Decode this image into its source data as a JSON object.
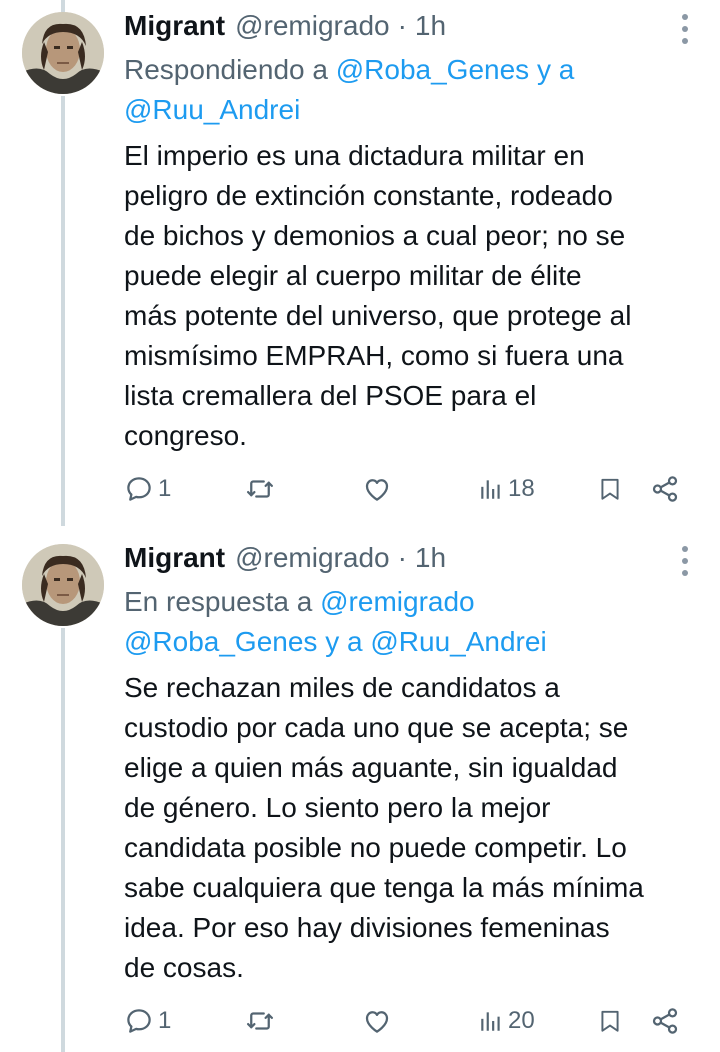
{
  "tweets": [
    {
      "name": "Migrant",
      "handle": "@remigrado",
      "dot": "·",
      "time": "1h",
      "reply_prefix": "Respondiendo a ",
      "reply_mention_1": "@Roba_Genes",
      "reply_mid": " y a",
      "reply_mention_2": "@Ruu_Andrei",
      "text": "El imperio es una dictadura militar en\npeligro de extinción constante, rodeado\nde bichos y demonios a cual peor; no se\npuede elegir al cuerpo militar de élite\nmás potente del universo, que protege al\nmismísimo EMPRAH, como si fuera una\nlista cremallera del PSOE para el\ncongreso.",
      "reply_count": "1",
      "views_count": "18"
    },
    {
      "name": "Migrant",
      "handle": "@remigrado",
      "dot": "·",
      "time": "1h",
      "reply_prefix": "En respuesta a ",
      "reply_mention_1": "@remigrado",
      "reply_mention_2": "@Roba_Genes",
      "reply_mid": " y a ",
      "reply_mention_3": "@Ruu_Andrei",
      "text": "Se rechazan miles de candidatos a\ncustodio por cada uno que se acepta; se\nelige a quien más aguante, sin igualdad\nde género. Lo siento pero la mejor\ncandidata posible no puede competir. Lo\nsabe cualquiera que tenga la más mínima\nidea. Por eso hay divisiones femeninas\nde cosas.",
      "reply_count": "1",
      "views_count": "20"
    }
  ],
  "icons": [
    "reply-icon",
    "retweet-icon",
    "like-icon",
    "views-icon",
    "bookmark-icon",
    "share-icon",
    "more-icon"
  ],
  "colors": {
    "mention": "#1d9bf0",
    "secondary": "#536471",
    "text": "#0f1419",
    "thread_line": "#cfd9de"
  }
}
